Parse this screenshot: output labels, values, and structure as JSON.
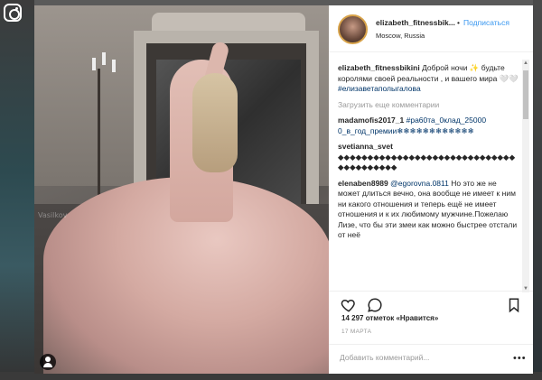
{
  "post": {
    "username": "elizabeth_fitnessbik...",
    "separator": "•",
    "follow_label": "Подписаться",
    "location": "Moscow, Russia",
    "watermark": "Vasilkov",
    "caption": {
      "username": "elizabeth_fitnessbikini",
      "text": " Доброй ночи ✨ будьте королями своей реальности , и вашего мира 🤍🤍",
      "hashtag": "#елизаветаполыгалова"
    },
    "load_more": "Загрузить еще комментарии",
    "comments": [
      {
        "username": "madamofis2017_1",
        "text": " ",
        "hashtag": "#ра60та_0клад_25000 0_в_год_премии❄❄❄❄❄❄❄❄❄❄❄❄"
      },
      {
        "username": "svetianna_svet",
        "text": " ◆◆◆◆◆◆◆◆◆◆◆◆◆◆◆◆◆◆◆◆◆◆◆◆◆◆◆◆◆◆◆◆◆◆◆◆◆◆◆◆",
        "hashtag": ""
      },
      {
        "username": "elenaben8989",
        "mention": "@egorovna.0811",
        "text": " Но это же не может длиться вечно, она вообще не имеет к ним ни какого отношения и теперь ещё не имеет отношения и к их любимому мужчине.Пожелаю Лизе, что бы эти змеи как можно быстрее отстали от неё"
      }
    ],
    "likes": "14 297 отметок «Нравится»",
    "date": "17 МАРТА",
    "add_comment_placeholder": "Добавить комментарий...",
    "more_icon": "•••"
  }
}
